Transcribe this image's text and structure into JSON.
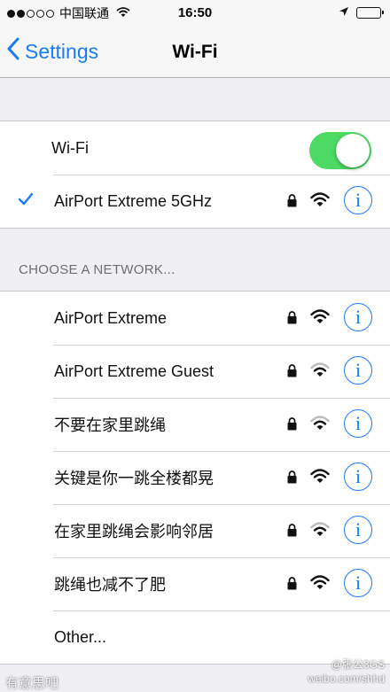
{
  "status_bar": {
    "carrier": "中国联通",
    "time": "16:50"
  },
  "nav": {
    "back_label": "Settings",
    "title": "Wi-Fi"
  },
  "wifi_toggle": {
    "label": "Wi-Fi",
    "on": true
  },
  "connected": {
    "name": "AirPort Extreme 5GHz",
    "secured": true
  },
  "section_header": "CHOOSE A NETWORK...",
  "networks": [
    {
      "name": "AirPort Extreme"
    },
    {
      "name": "AirPort Extreme Guest"
    },
    {
      "name": "不要在家里跳绳"
    },
    {
      "name": "关键是你一跳全楼都晃"
    },
    {
      "name": "在家里跳绳会影响邻居"
    },
    {
      "name": "跳绳也减不了肥"
    }
  ],
  "other_label": "Other...",
  "info_glyph": "i",
  "watermark": {
    "left": "有意思吧",
    "right_line1": "@张公3GS",
    "right_line2": "weibo.com/shhd"
  },
  "colors": {
    "accent": "#1a7cf0",
    "toggle_on": "#4cd964"
  },
  "icons": [
    "back-chevron-icon",
    "checkmark-icon",
    "lock-icon",
    "wifi-signal-icon",
    "info-icon",
    "location-arrow-icon",
    "battery-icon"
  ]
}
